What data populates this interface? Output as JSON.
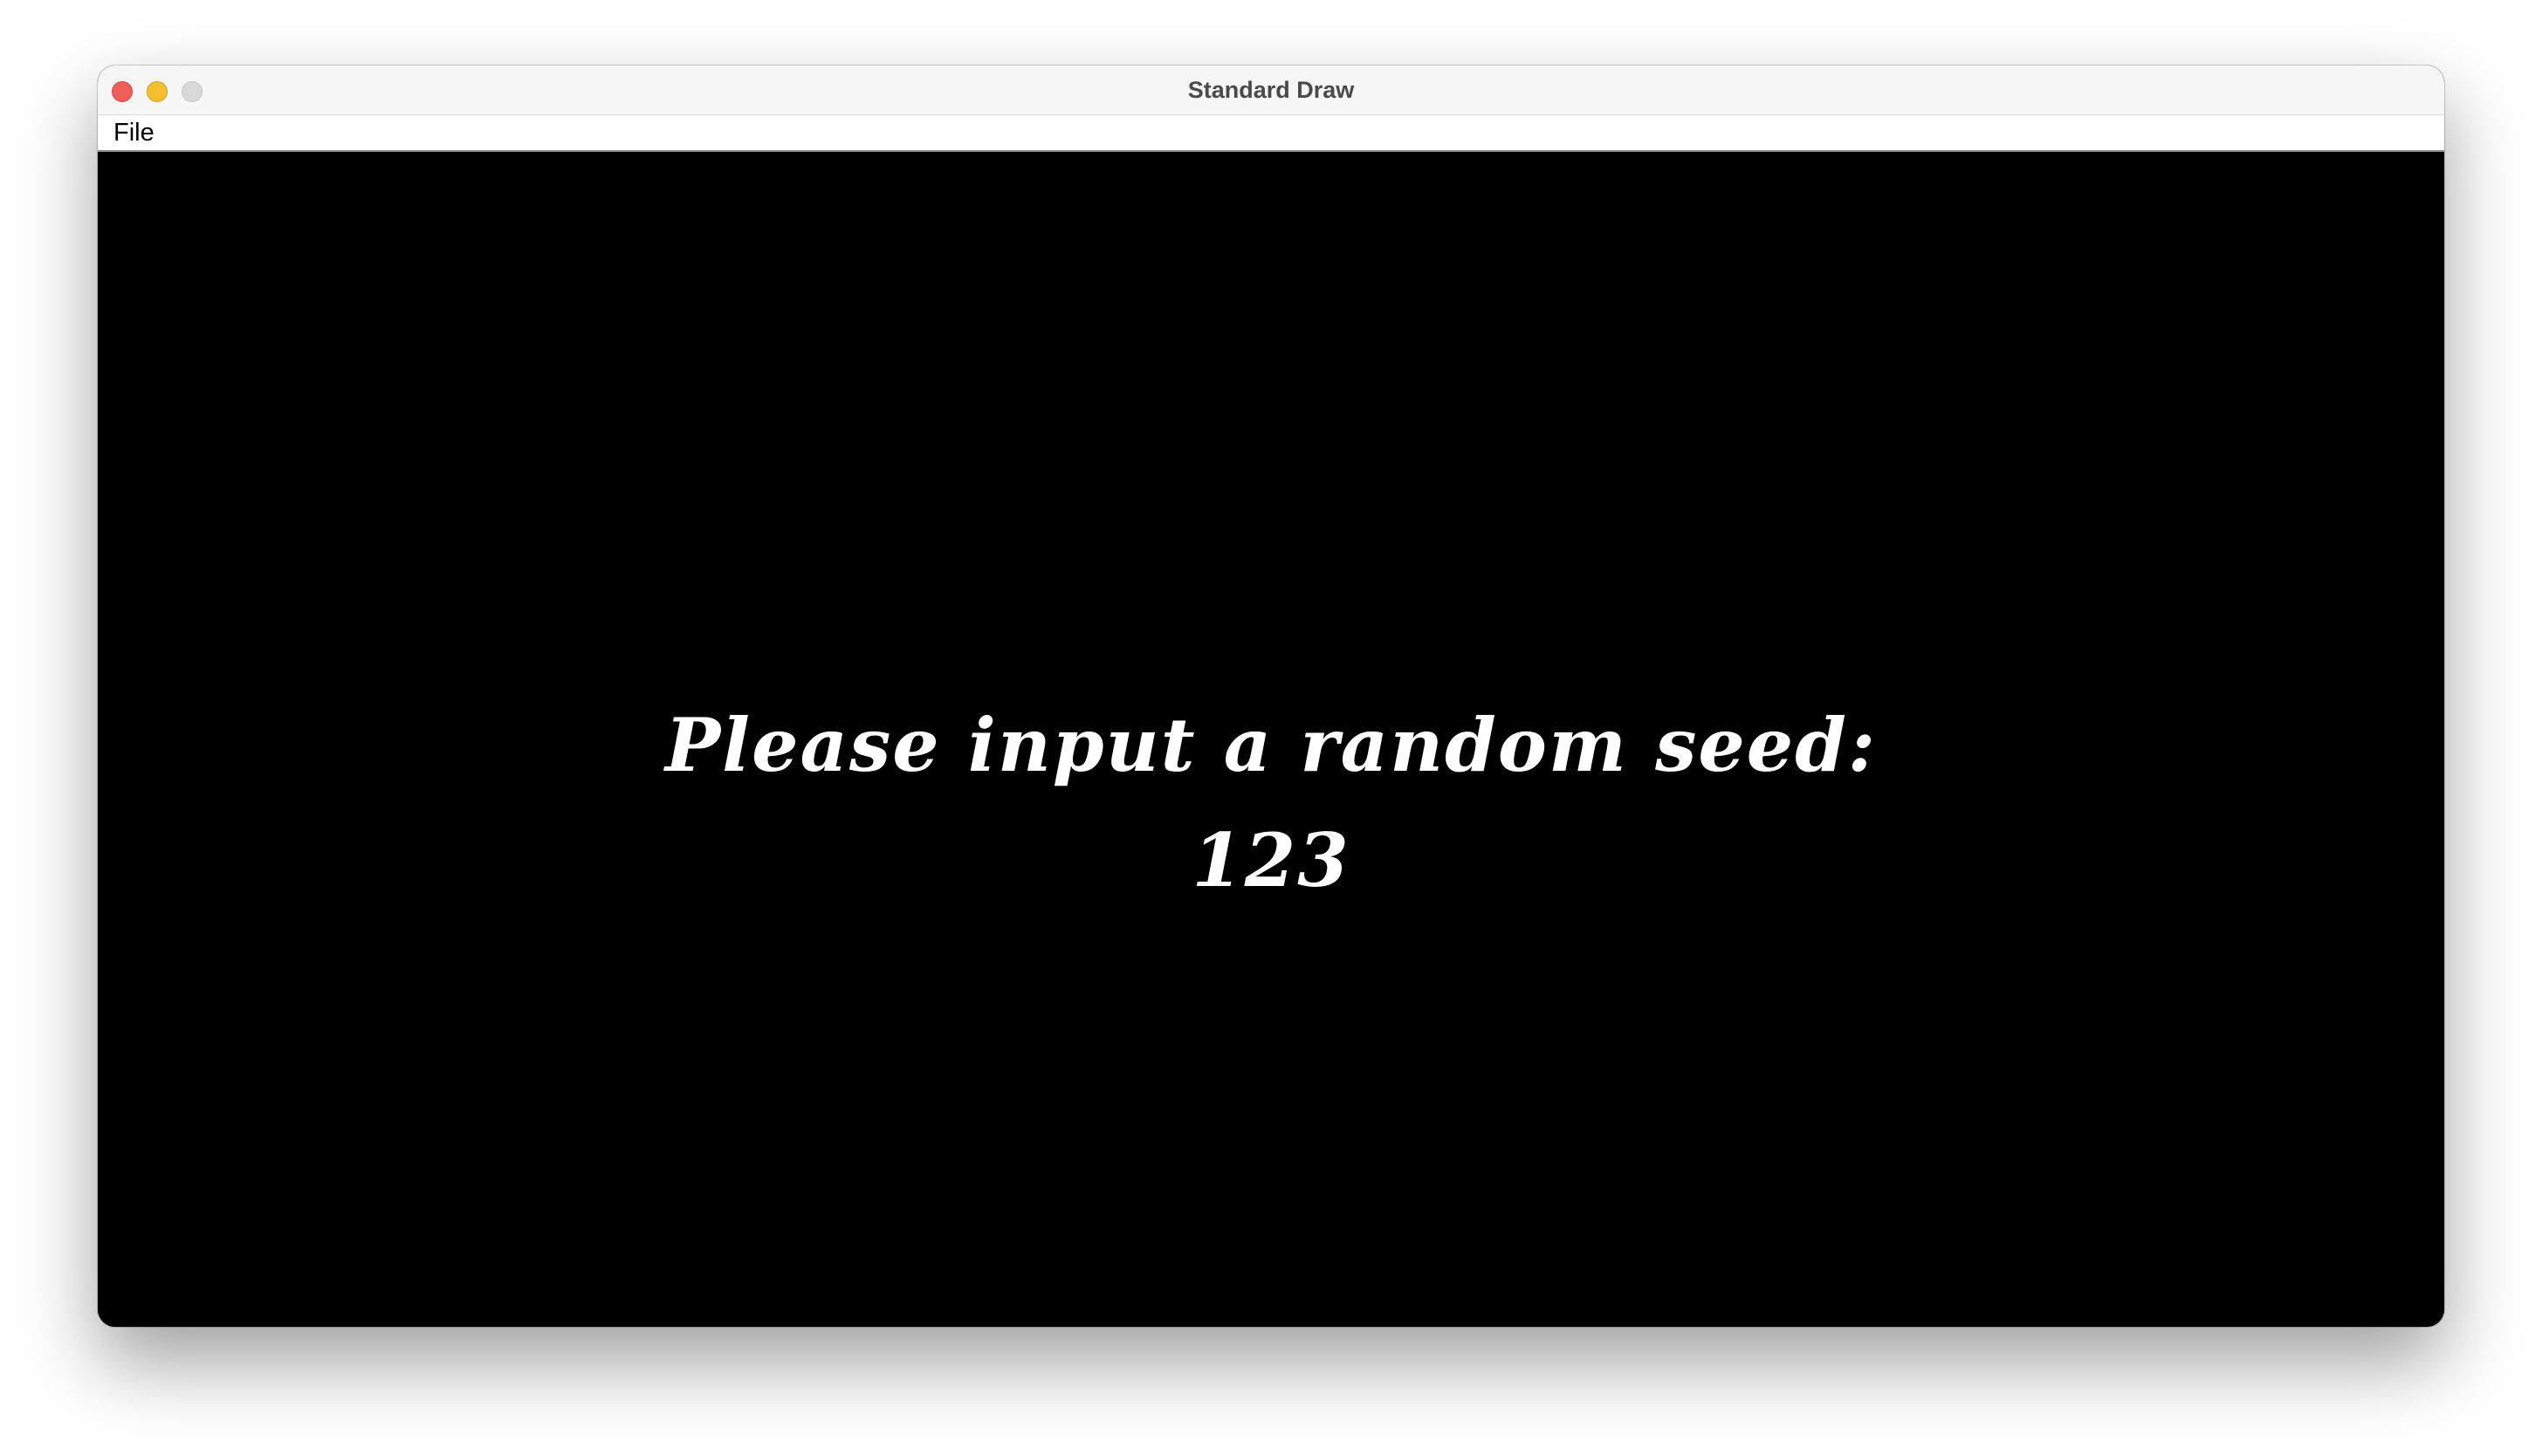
{
  "window": {
    "title": "Standard Draw"
  },
  "menubar": {
    "items": [
      {
        "label": "File"
      }
    ]
  },
  "canvas": {
    "background": "#000000",
    "text_color": "#ffffff",
    "prompt": "Please input a random seed:",
    "input_value": "123"
  },
  "traffic_lights": {
    "close_color": "#ee5f57",
    "minimize_color": "#f5bd30",
    "zoom_color": "#d9d9d9"
  }
}
